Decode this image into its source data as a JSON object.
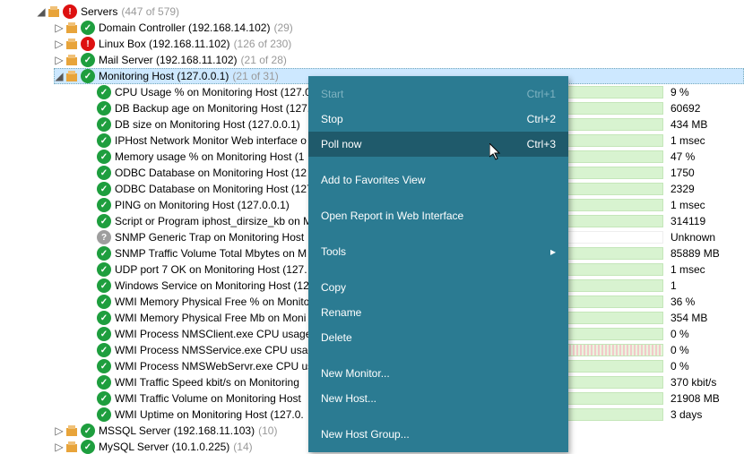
{
  "tree": {
    "root": {
      "label": "Servers",
      "count": "(447 of 579)",
      "status": "red",
      "expanded": true
    },
    "servers": [
      {
        "label": "Domain Controller (192.168.14.102)",
        "count": "(29)",
        "status": "green",
        "expanded": false
      },
      {
        "label": "Linux Box (192.168.11.102)",
        "count": "(126 of 230)",
        "status": "red",
        "expanded": false
      },
      {
        "label": "Mail Server (192.168.11.102)",
        "count": "(21 of 28)",
        "status": "green",
        "expanded": false
      },
      {
        "label": "Monitoring Host (127.0.0.1)",
        "count": "(21 of 31)",
        "status": "green",
        "expanded": true,
        "selected": true
      },
      {
        "label": "MSSQL Server (192.168.11.103)",
        "count": "(10)",
        "status": "green",
        "expanded": false
      },
      {
        "label": "MySQL Server (10.1.0.225)",
        "count": "(14)",
        "status": "green",
        "expanded": false
      }
    ],
    "monitors": [
      {
        "label": "CPU Usage % on Monitoring Host (127.0",
        "status": "green",
        "value": "9 %",
        "spark": "green"
      },
      {
        "label": "DB Backup age on Monitoring Host (127.",
        "status": "green",
        "value": "60692",
        "spark": "green"
      },
      {
        "label": "DB size on Monitoring Host (127.0.0.1)",
        "status": "green",
        "value": "434 MB",
        "spark": "green"
      },
      {
        "label": "IPHost Network Monitor Web interface o",
        "status": "green",
        "value": "1 msec",
        "spark": "green"
      },
      {
        "label": "Memory usage % on Monitoring Host (1",
        "status": "green",
        "value": "47 %",
        "spark": "green"
      },
      {
        "label": "ODBC  Database on Monitoring Host (12",
        "status": "green",
        "value": "1750",
        "spark": "green"
      },
      {
        "label": "ODBC Database on Monitoring Host (127",
        "status": "green",
        "value": "2329",
        "spark": "green"
      },
      {
        "label": "PING on Monitoring Host (127.0.0.1)",
        "status": "green",
        "value": "1 msec",
        "spark": "green"
      },
      {
        "label": "Script or Program iphost_dirsize_kb on M",
        "status": "green",
        "value": "314119",
        "spark": "green"
      },
      {
        "label": "SNMP Generic Trap on Monitoring Host ",
        "status": "gray",
        "value": "Unknown",
        "spark": "empty"
      },
      {
        "label": "SNMP Traffic Volume Total Mbytes on M",
        "status": "green",
        "value": "85889 MB",
        "spark": "green"
      },
      {
        "label": "UDP port 7 OK on Monitoring Host (127.",
        "status": "green",
        "value": "1 msec",
        "spark": "green"
      },
      {
        "label": "Windows Service on Monitoring Host (12",
        "status": "green",
        "value": "1",
        "spark": "green"
      },
      {
        "label": "WMI Memory Physical Free % on Monito",
        "status": "green",
        "value": "36 %",
        "spark": "green"
      },
      {
        "label": "WMI Memory Physical Free Mb on Moni",
        "status": "green",
        "value": "354 MB",
        "spark": "green"
      },
      {
        "label": "WMI Process NMSClient.exe CPU usage o",
        "status": "green",
        "value": "0 %",
        "spark": "green"
      },
      {
        "label": "WMI Process NMSService.exe CPU usage",
        "status": "green",
        "value": "0 %",
        "spark": "pink"
      },
      {
        "label": "WMI Process NMSWebServr.exe CPU usa",
        "status": "green",
        "value": "0 %",
        "spark": "green"
      },
      {
        "label": "WMI Traffic Speed kbit/s on Monitoring ",
        "status": "green",
        "value": "370 kbit/s",
        "spark": "green"
      },
      {
        "label": "WMI Traffic Volume on Monitoring Host",
        "status": "green",
        "value": "21908 MB",
        "spark": "green"
      },
      {
        "label": "WMI Uptime on Monitoring Host (127.0.",
        "status": "green",
        "value": "3 days",
        "spark": "green"
      }
    ]
  },
  "context_menu": {
    "items": [
      {
        "label": "Start",
        "shortcut": "Ctrl+1",
        "disabled": true
      },
      {
        "label": "Stop",
        "shortcut": "Ctrl+2"
      },
      {
        "label": "Poll now",
        "shortcut": "Ctrl+3",
        "hover": true
      },
      {
        "sep": true
      },
      {
        "label": "Add to Favorites View"
      },
      {
        "sep": true
      },
      {
        "label": "Open Report in Web Interface"
      },
      {
        "sep": true
      },
      {
        "label": "Tools",
        "submenu": true
      },
      {
        "sep": true
      },
      {
        "label": "Copy"
      },
      {
        "label": "Rename"
      },
      {
        "label": "Delete"
      },
      {
        "sep": true
      },
      {
        "label": "New Monitor..."
      },
      {
        "label": "New Host..."
      },
      {
        "sep": true
      },
      {
        "label": "New Host Group..."
      }
    ]
  }
}
